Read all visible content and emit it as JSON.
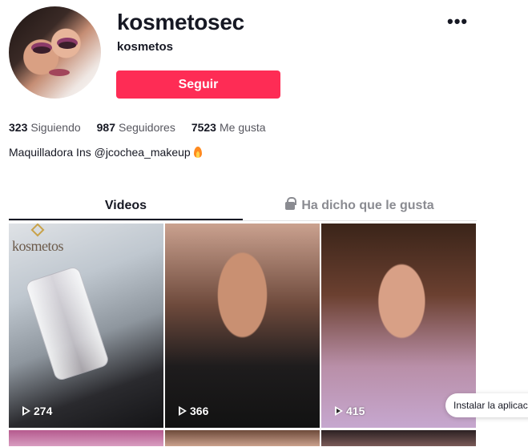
{
  "profile": {
    "username": "kosmetosec",
    "nickname": "kosmetos",
    "follow_label": "Seguir",
    "more_label": "•••",
    "bio": "Maquilladora Ins @jcochea_makeup"
  },
  "stats": {
    "following_count": "323",
    "following_label": "Siguiendo",
    "followers_count": "987",
    "followers_label": "Seguidores",
    "likes_count": "7523",
    "likes_label": "Me gusta"
  },
  "tabs": {
    "videos": "Videos",
    "liked": "Ha dicho que le gusta"
  },
  "videos": [
    {
      "views": "274",
      "brand": "kosmetos"
    },
    {
      "views": "366"
    },
    {
      "views": "415"
    }
  ],
  "install_app": "Instalar la aplicación",
  "colors": {
    "accent": "#fe2c55",
    "text": "#161823",
    "muted": "#8a8b91"
  }
}
